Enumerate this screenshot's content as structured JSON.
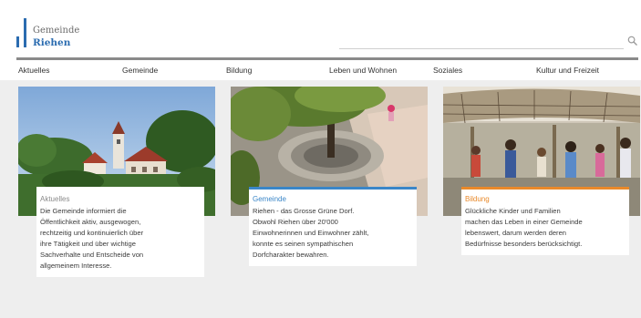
{
  "header": {
    "logo_line1": "Gemeinde",
    "logo_line2": "Riehen",
    "search_placeholder": ""
  },
  "nav": {
    "items": [
      "Aktuelles",
      "Gemeinde",
      "Bildung",
      "Leben und Wohnen",
      "Soziales",
      "Kultur und Freizeit"
    ]
  },
  "cards": [
    {
      "category": "Aktuelles",
      "category_color": "#8a8a8a",
      "lines": [
        "Die Gemeinde informiert die",
        "Öffentlichkeit aktiv, ausgewogen,",
        "rechtzeitig und kontinuierlich über",
        "ihre Tätigkeit und über wichtige",
        "Sachverhalte und Entscheide von",
        "allgemeinem Interesse."
      ]
    },
    {
      "category": "Gemeinde",
      "category_color": "#3a86c8",
      "lines": [
        "Riehen - das Grosse Grüne Dorf.",
        "Obwohl Riehen über 20'000",
        "Einwohnerinnen und Einwohner zählt,",
        "konnte es seinen sympathischen",
        "Dorfcharakter bewahren."
      ]
    },
    {
      "category": "Bildung",
      "category_color": "#e9892a",
      "lines": [
        "Glückliche Kinder und Familien",
        "machen das Leben in einer Gemeinde",
        "lebenswert, darum werden deren",
        "Bedürfnisse besonders berücksichtigt."
      ]
    }
  ],
  "colors": {
    "brand_blue": "#2b6cb0",
    "accent_blue": "#3a86c8",
    "accent_orange": "#e9892a"
  }
}
